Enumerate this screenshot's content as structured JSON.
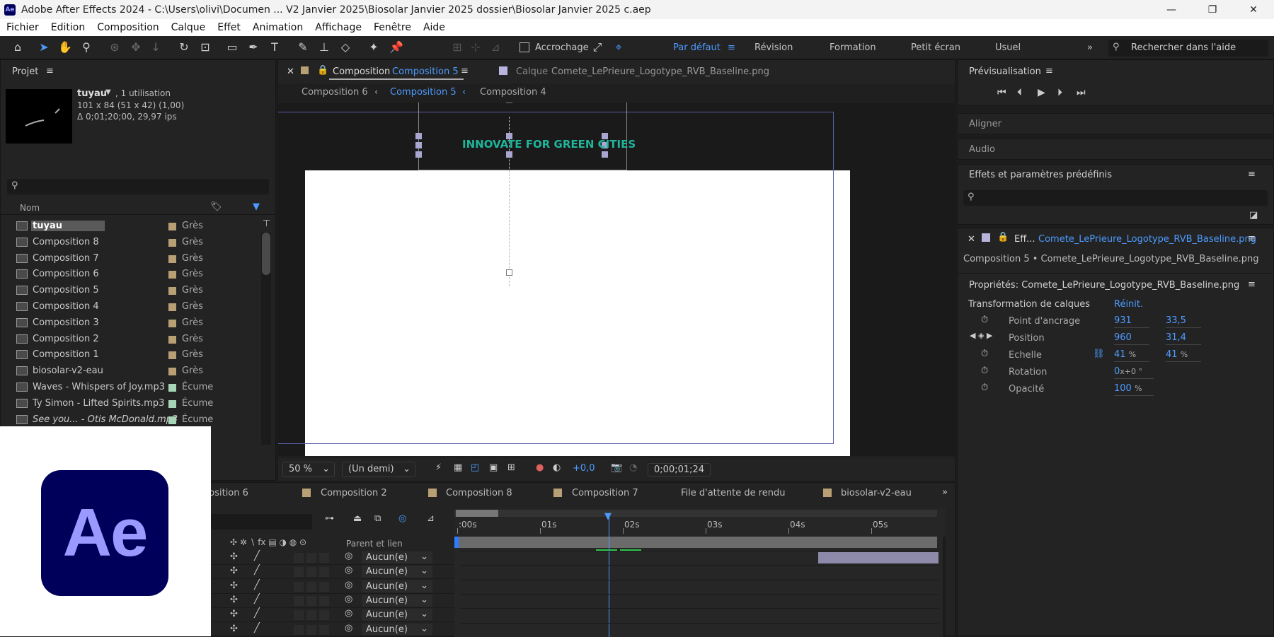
{
  "app": {
    "title": "Adobe After Effects 2024 - C:\\Users\\olivi\\Documen ... V2 Janvier 2025\\Biosolar Janvier 2025 dossier\\Biosolar Janvier 2025 c.aep",
    "logo": "Ae"
  },
  "window": {
    "minimize": "—",
    "restore": "❐",
    "close": "✕"
  },
  "menu": [
    "Fichier",
    "Edition",
    "Composition",
    "Calque",
    "Effet",
    "Animation",
    "Affichage",
    "Fenêtre",
    "Aide"
  ],
  "toolbar": {
    "snap_label": "Accrochage",
    "workspaces": [
      "Par défaut",
      "Révision",
      "Formation",
      "Petit écran",
      "Usuel"
    ],
    "search_placeholder": "Rechercher dans l'aide"
  },
  "project": {
    "title": "Projet",
    "selected_name": "tuyau",
    "usage": ", 1 utilisation",
    "dims": "101 x 84  (51 x 42) (1,00)",
    "duration": "Δ 0;01;20;00, 29,97 ips",
    "col_name": "Nom",
    "items": [
      {
        "name": "tuyau",
        "label": "Grès",
        "color": "#b9a074"
      },
      {
        "name": "Composition 8",
        "label": "Grès",
        "color": "#b9a074"
      },
      {
        "name": "Composition 7",
        "label": "Grès",
        "color": "#b9a074"
      },
      {
        "name": "Composition 6",
        "label": "Grès",
        "color": "#b9a074"
      },
      {
        "name": "Composition 5",
        "label": "Grès",
        "color": "#b9a074"
      },
      {
        "name": "Composition 4",
        "label": "Grès",
        "color": "#b9a074"
      },
      {
        "name": "Composition 3",
        "label": "Grès",
        "color": "#b9a074"
      },
      {
        "name": "Composition 2",
        "label": "Grès",
        "color": "#b9a074"
      },
      {
        "name": "Composition 1",
        "label": "Grès",
        "color": "#b9a074"
      },
      {
        "name": "biosolar-v2-eau",
        "label": "Grès",
        "color": "#b9a074"
      },
      {
        "name": "Waves - Whispers of Joy.mp3",
        "label": "Écume",
        "color": "#a8d4b8"
      },
      {
        "name": "Ty Simon - Lifted Spirits.mp3",
        "label": "Écume",
        "color": "#a8d4b8"
      },
      {
        "name": "See you... - Otis McDonald.mp3",
        "label": "Écume",
        "color": "#a8d4b8"
      }
    ]
  },
  "viewer": {
    "tab_prefix": "Composition",
    "tab_active": "Composition 5",
    "layer_prefix": "Calque",
    "layer_name": "Comete_LePrieure_Logotype_RVB_Baseline.png",
    "nav": [
      "Composition 6",
      "Composition 5",
      "Composition 4"
    ],
    "canvas_text": "INNOVATE FOR GREEN CITIES",
    "zoom": "50 %",
    "resolution": "(Un demi)",
    "exposure": "+0,0",
    "timecode": "0;00;01;24"
  },
  "timeline": {
    "tabs": [
      "position 6",
      "Composition 2",
      "Composition 8",
      "Composition 7",
      "File d'attente de rendu",
      "biosolar-v2-eau"
    ],
    "parent_header": "Parent et lien",
    "parent_value": "Aucun(e)",
    "ruler": [
      ":00s",
      "01s",
      "02s",
      "03s",
      "04s",
      "05s"
    ],
    "layer_rows": 6
  },
  "preview": {
    "title": "Prévisualisation"
  },
  "panels": {
    "align": "Aligner",
    "audio": "Audio",
    "effects": "Effets et paramètres prédéfinis"
  },
  "effects_controls": {
    "tab_prefix": "Eff...",
    "tab_name": "Comete_LePrieure_Logotype_RVB_Baseline.png",
    "path": "Composition 5 • Comete_LePrieure_Logotype_RVB_Baseline.png"
  },
  "properties": {
    "title": "Propriétés: Comete_LePrieure_Logotype_RVB_Baseline.png",
    "section": "Transformation de calques",
    "reset": "Réinit.",
    "anchor": {
      "label": "Point d'ancrage",
      "x": "931",
      "y": "33,5"
    },
    "position": {
      "label": "Position",
      "x": "960",
      "y": "31,4"
    },
    "scale": {
      "label": "Echelle",
      "x": "41",
      "y": "41",
      "unit": "%"
    },
    "rotation": {
      "label": "Rotation",
      "value": "0",
      "unit": "x+0 °"
    },
    "opacity": {
      "label": "Opacité",
      "value": "100",
      "unit": "%"
    }
  },
  "badge": {
    "text": "Ae"
  }
}
